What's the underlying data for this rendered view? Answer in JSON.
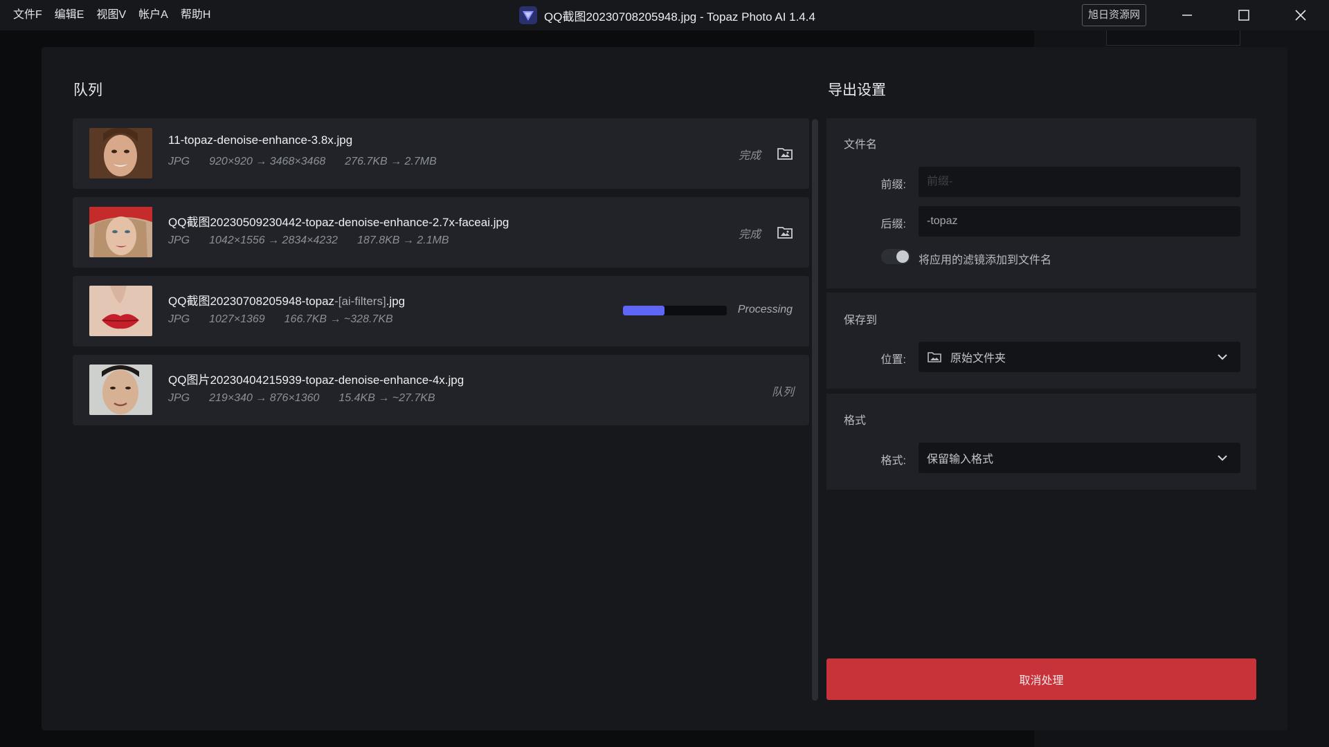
{
  "menu": [
    "文件F",
    "编辑E",
    "视图V",
    "帐户A",
    "帮助H"
  ],
  "window": {
    "title": "QQ截图20230708205948.jpg - Topaz Photo AI 1.4.4",
    "badge": "旭日资源网"
  },
  "queue": {
    "title": "队列",
    "items": [
      {
        "name": "11-topaz-denoise-enhance-3.8x.jpg",
        "name_suffix": "",
        "name_ext": "",
        "format": "JPG",
        "dims": "920×920 → 3468×3468",
        "size": "276.7KB → 2.7MB",
        "status": "完成"
      },
      {
        "name": "QQ截图20230509230442-topaz-denoise-enhance-2.7x-faceai.jpg",
        "name_suffix": "",
        "name_ext": "",
        "format": "JPG",
        "dims": "1042×1556 → 2834×4232",
        "size": "187.8KB → 2.1MB",
        "status": "完成"
      },
      {
        "name": "QQ截图20230708205948-topaz",
        "name_suffix": "-[ai-filters]",
        "name_ext": ".jpg",
        "format": "JPG",
        "dims": "1027×1369",
        "size": "166.7KB → ~328.7KB",
        "status": "Processing",
        "progress": 0.4
      },
      {
        "name": "QQ图片20230404215939-topaz-denoise-enhance-4x.jpg",
        "name_suffix": "",
        "name_ext": "",
        "format": "JPG",
        "dims": "219×340 → 876×1360",
        "size": "15.4KB → ~27.7KB",
        "status": "队列"
      }
    ]
  },
  "export": {
    "title": "导出设置",
    "filename": {
      "title": "文件名",
      "prefix_label": "前缀:",
      "prefix_placeholder": "前缀-",
      "suffix_label": "后缀:",
      "suffix_value": "-topaz",
      "toggle_label": "将应用的滤镜添加到文件名"
    },
    "save": {
      "title": "保存到",
      "location_label": "位置:",
      "location_value": "原始文件夹"
    },
    "format": {
      "title": "格式",
      "format_label": "格式:",
      "format_value": "保留输入格式"
    },
    "cancel_label": "取消处理"
  }
}
